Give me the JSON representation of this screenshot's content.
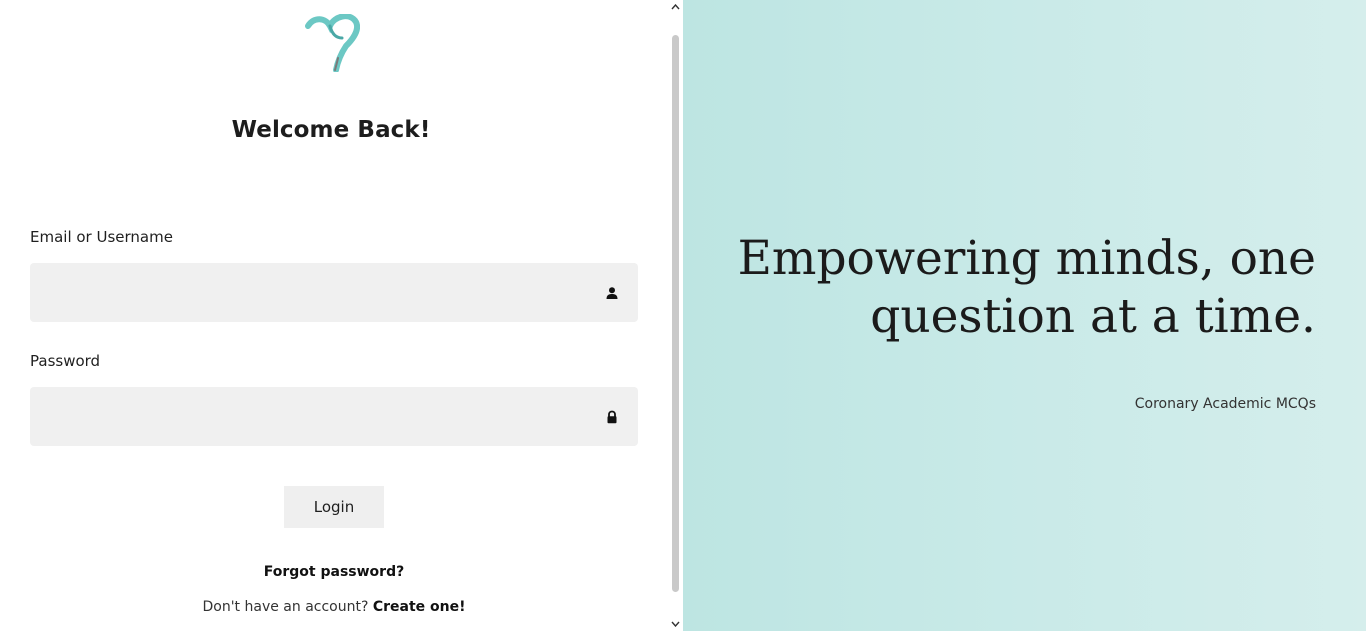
{
  "login": {
    "heading": "Welcome Back!",
    "email_label": "Email or Username",
    "email_value": "",
    "email_placeholder": "",
    "password_label": "Password",
    "password_value": "",
    "password_placeholder": "",
    "login_button": "Login",
    "forgot_password": "Forgot password?",
    "no_account_text": "Don't have an account?",
    "create_account": "Create one!"
  },
  "hero": {
    "tagline_line1": "Empowering minds, one",
    "tagline_line2": "question at a time.",
    "brand": "Coronary Academic MCQs"
  },
  "icons": {
    "logo": "heart-logo-icon",
    "email_field_icon": "user-icon",
    "password_field_icon": "lock-icon",
    "scroll_up": "chevron-up-icon",
    "scroll_down": "chevron-down-icon"
  },
  "colors": {
    "logo_teal": "#6cc8c4",
    "logo_teal_dark": "#4aa8a6",
    "input_background": "#f0f0f0",
    "hero_gradient_start": "#bde5e2",
    "hero_gradient_end": "#d5eeec"
  }
}
